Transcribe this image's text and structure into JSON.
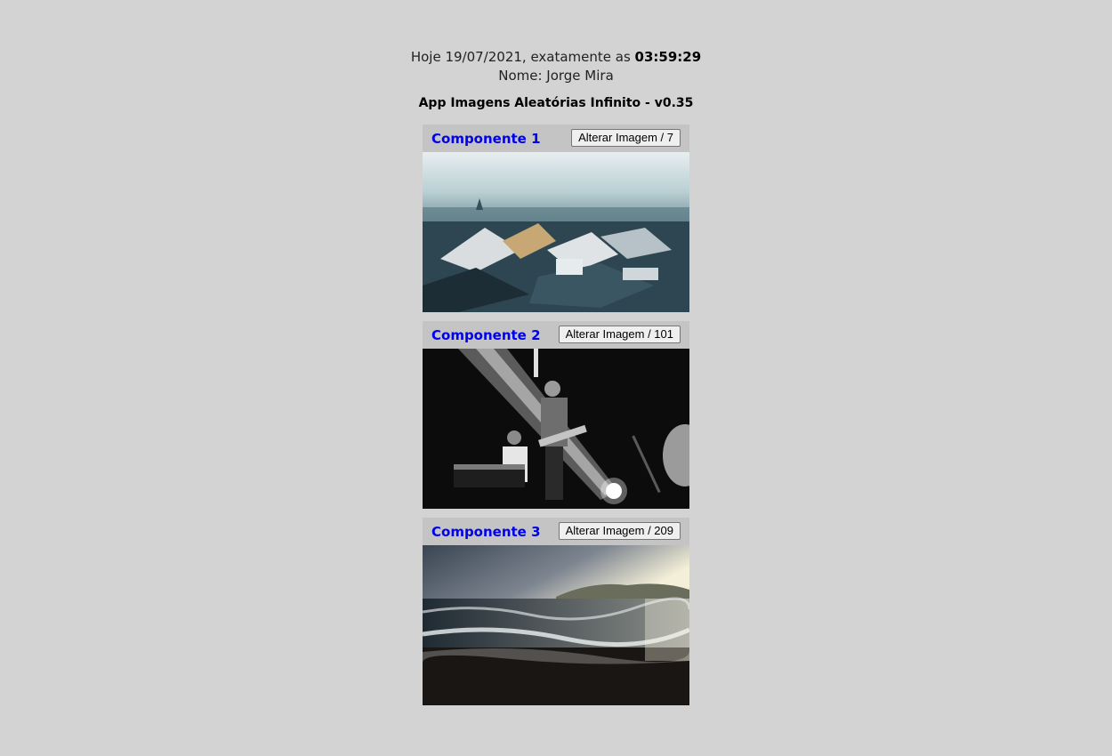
{
  "header": {
    "date_prefix": "Hoje 19/07/2021, exatamente as ",
    "time": "03:59:29",
    "name_line": "Nome: Jorge Mira"
  },
  "app_title": "App Imagens Aleatórias Infinito - v0.35",
  "components": [
    {
      "title": "Componente 1",
      "button_label": "Alterar Imagem / 7",
      "image": "city-rooftops-snow-photo"
    },
    {
      "title": "Componente 2",
      "button_label": "Alterar Imagem / 101",
      "image": "concert-musicians-bw-photo"
    },
    {
      "title": "Componente 3",
      "button_label": "Alterar Imagem / 209",
      "image": "ocean-beach-sunset-photo"
    }
  ],
  "colors": {
    "background": "#d3d3d3",
    "card_bar": "#c4c4c4",
    "component_title": "#0000ee"
  }
}
